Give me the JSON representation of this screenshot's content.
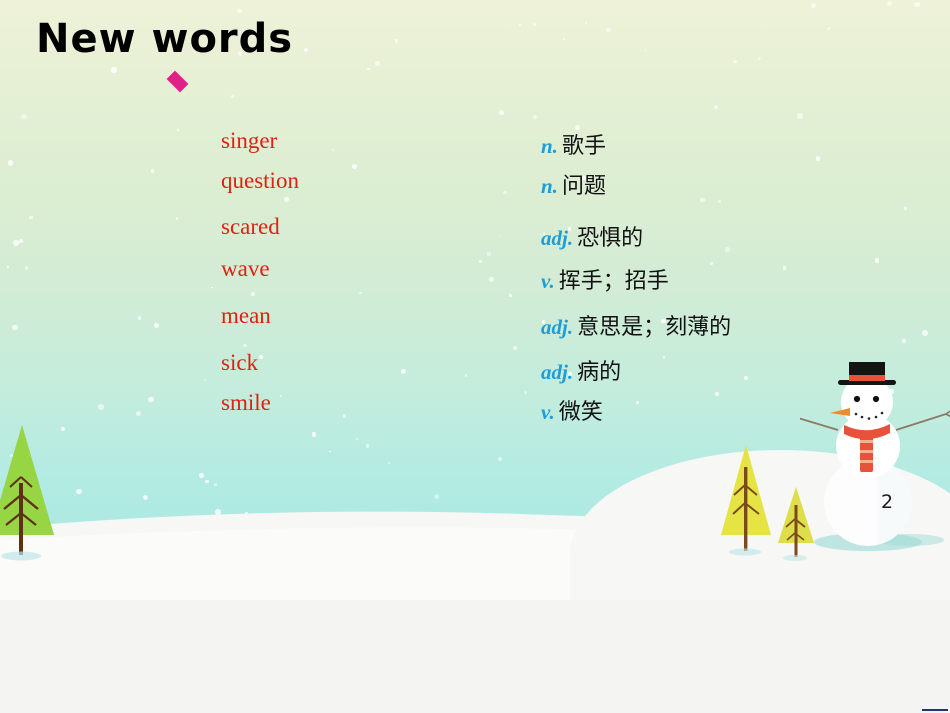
{
  "slide": {
    "title": "New words",
    "page_number": "2",
    "bullet_marker": "diamond",
    "colors": {
      "title": "#000000",
      "bullet": "#e0218a",
      "english_word": "#dd2211",
      "part_of_speech": "#1f9dd9",
      "definition": "#111111",
      "background_top": "#eef2d8",
      "background_bottom": "#a4e8e1",
      "snow": "#f7f7f5"
    },
    "vocabulary": [
      {
        "word": "singer",
        "pos": "n.",
        "definition": "歌手"
      },
      {
        "word": "question",
        "pos": "n.",
        "definition": "问题"
      },
      {
        "word": "scared",
        "pos": "adj.",
        "definition": "恐惧的"
      },
      {
        "word": "wave",
        "pos": "v.",
        "definition": "挥手；招手"
      },
      {
        "word": "mean",
        "pos": "adj.",
        "definition": "意思是；刻薄的"
      },
      {
        "word": "sick",
        "pos": "adj.",
        "definition": "病的"
      },
      {
        "word": "smile",
        "pos": "v.",
        "definition": "微笑"
      }
    ],
    "decorations": {
      "snowman": "snowman-illustration",
      "trees": [
        "green-pine-tree-left",
        "yellow-tree-large",
        "yellow-tree-small"
      ],
      "ground": "snow-hill"
    }
  }
}
